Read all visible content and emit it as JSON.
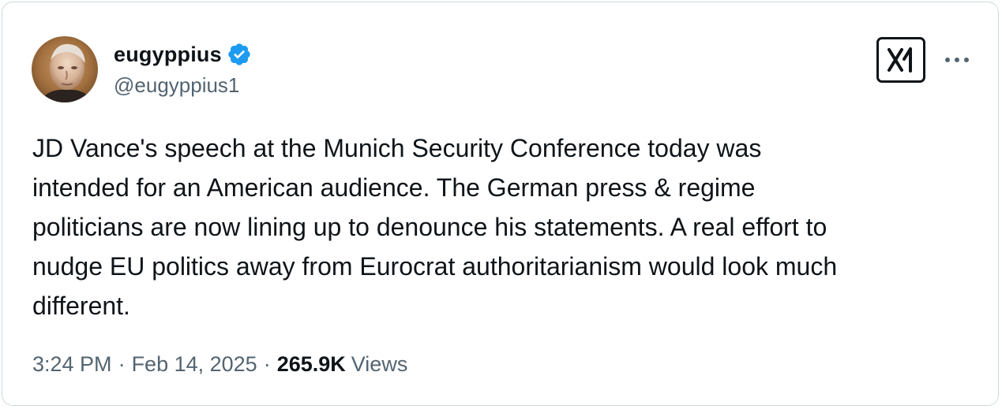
{
  "author": {
    "display_name": "eugyppius",
    "handle": "@eugyppius1",
    "verified": true,
    "verified_color": "#1d9bf0"
  },
  "header": {
    "logo_icon": "x-logo-icon",
    "more_icon": "more-options-icon"
  },
  "tweet": {
    "text_lines": [
      "JD Vance's speech at the Munich Security Conference today was",
      "intended for an American audience. The German press & regime",
      "politicians are now lining up to denounce his statements. A real effort to",
      "nudge EU politics away from Eurocrat authoritarianism would look much",
      "different."
    ]
  },
  "meta": {
    "time": "3:24 PM",
    "separator": "·",
    "date": "Feb 14, 2025",
    "views_count": "265.9K",
    "views_label": "Views"
  },
  "colors": {
    "text_primary": "#0f1419",
    "text_secondary": "#536471",
    "border": "#cfd9de"
  }
}
